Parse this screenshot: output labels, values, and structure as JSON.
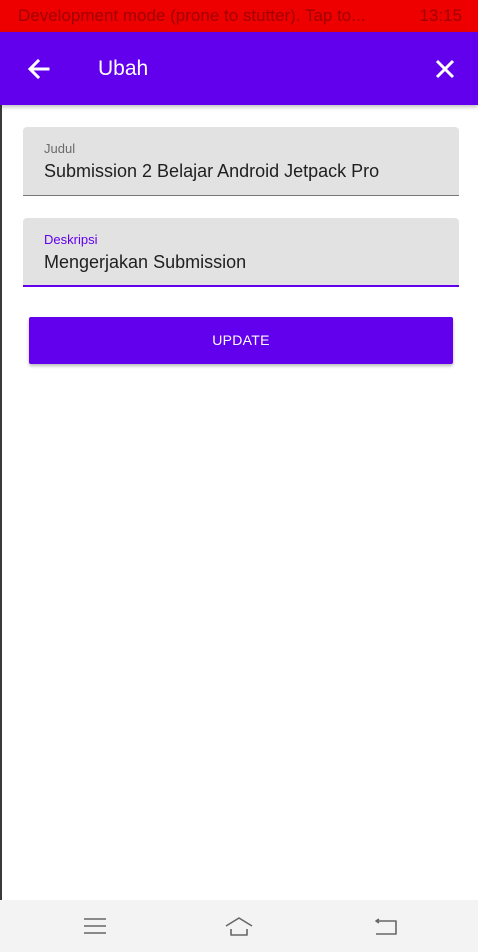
{
  "status_bar": {
    "text": "Development mode (prone to stutter). Tap to...",
    "time": "13:15"
  },
  "app_bar": {
    "title": "Ubah",
    "back_icon": "arrow-left-icon",
    "close_icon": "close-icon"
  },
  "form": {
    "judul": {
      "label": "Judul",
      "value": "Submission 2 Belajar Android Jetpack Pro"
    },
    "deskripsi": {
      "label": "Deskripsi",
      "value": "Mengerjakan Submission"
    },
    "update_label": "UPDATE"
  },
  "nav_bar": {
    "menu_icon": "menu-icon",
    "home_icon": "home-icon",
    "back_icon": "back-icon"
  },
  "colors": {
    "primary": "#6200ee",
    "status_bar": "#ee0000",
    "field_bg": "#e2e2e2"
  }
}
